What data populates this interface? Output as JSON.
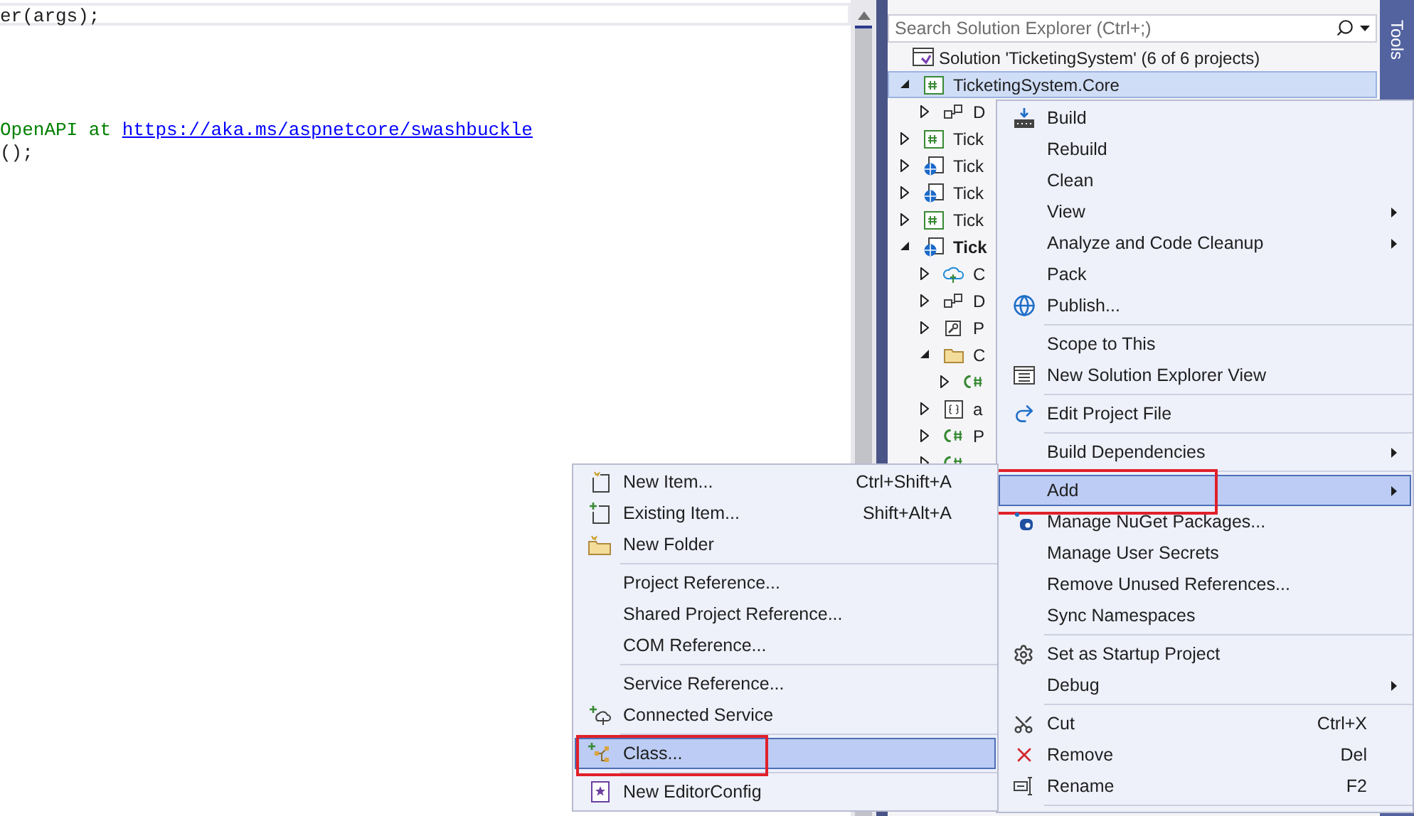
{
  "editor": {
    "lines": [
      {
        "kind": "code",
        "current": true,
        "segments": [
          {
            "kind": "code",
            "text": "er(args);"
          }
        ]
      },
      {
        "kind": "blank",
        "current": false
      },
      {
        "kind": "blank",
        "current": false
      },
      {
        "kind": "blank",
        "current": false
      },
      {
        "kind": "blank",
        "current": false
      },
      {
        "kind": "code",
        "current": false,
        "segments": [
          {
            "kind": "comment",
            "text": "OpenAPI at "
          },
          {
            "kind": "link",
            "text": "https://aka.ms/aspnetcore/swashbuckle"
          }
        ]
      },
      {
        "kind": "code",
        "current": false,
        "segments": [
          {
            "kind": "code",
            "text": "();"
          }
        ]
      }
    ]
  },
  "solution_explorer": {
    "search": {
      "placeholder": "Search Solution Explorer (Ctrl+;)"
    },
    "side_tab": "Tools",
    "solution": {
      "label": "Solution 'TicketingSystem' (6 of 6 projects)"
    },
    "projects": [
      {
        "kind": "csproj",
        "label": "TicketingSystem.Core",
        "expanded": true,
        "selected": true,
        "startup": false,
        "children": [
          {
            "kind": "deps",
            "label": "D",
            "expanded": false,
            "selected": false
          }
        ]
      },
      {
        "kind": "csproj",
        "label": "Tick",
        "expanded": false,
        "selected": false,
        "startup": false
      },
      {
        "kind": "webproj",
        "label": "Tick",
        "expanded": false,
        "selected": false,
        "startup": false
      },
      {
        "kind": "webproj",
        "label": "Tick",
        "expanded": false,
        "selected": false,
        "startup": false
      },
      {
        "kind": "csproj",
        "label": "Tick",
        "expanded": false,
        "selected": false,
        "startup": false
      },
      {
        "kind": "webproj",
        "label": "Tick",
        "expanded": true,
        "selected": false,
        "startup": true,
        "children": [
          {
            "kind": "connected",
            "label": "C",
            "expanded": false,
            "selected": false
          },
          {
            "kind": "deps",
            "label": "D",
            "expanded": false,
            "selected": false
          },
          {
            "kind": "props",
            "label": "P",
            "expanded": false,
            "selected": false
          },
          {
            "kind": "folder",
            "label": "C",
            "expanded": true,
            "selected": false,
            "children": [
              {
                "kind": "csfile",
                "expanded": false,
                "selected": false
              }
            ]
          },
          {
            "kind": "json",
            "label": "a",
            "expanded": false,
            "selected": false
          },
          {
            "kind": "csfile",
            "label": "P",
            "expanded": false,
            "selected": false
          },
          {
            "kind": "csfile",
            "expanded": false,
            "selected": false
          }
        ]
      }
    ]
  },
  "context_menu": {
    "items": [
      {
        "kind": "item",
        "label": "Build",
        "submenu": false,
        "selected": false
      },
      {
        "kind": "item",
        "label": "Rebuild",
        "submenu": false,
        "selected": false
      },
      {
        "kind": "item",
        "label": "Clean",
        "submenu": false,
        "selected": false
      },
      {
        "kind": "item",
        "label": "View",
        "submenu": true,
        "selected": false
      },
      {
        "kind": "item",
        "label": "Analyze and Code Cleanup",
        "submenu": true,
        "selected": false
      },
      {
        "kind": "item",
        "label": "Pack",
        "submenu": false,
        "selected": false
      },
      {
        "kind": "item",
        "label": "Publish...",
        "submenu": false,
        "selected": false
      },
      {
        "kind": "separator"
      },
      {
        "kind": "item",
        "label": "Scope to This",
        "submenu": false,
        "selected": false
      },
      {
        "kind": "item",
        "label": "New Solution Explorer View",
        "submenu": false,
        "selected": false
      },
      {
        "kind": "separator"
      },
      {
        "kind": "item",
        "label": "Edit Project File",
        "submenu": false,
        "selected": false
      },
      {
        "kind": "separator"
      },
      {
        "kind": "item",
        "label": "Build Dependencies",
        "submenu": true,
        "selected": false
      },
      {
        "kind": "separator"
      },
      {
        "kind": "item",
        "label": "Add",
        "submenu": true,
        "selected": true,
        "callout": true
      },
      {
        "kind": "item",
        "label": "Manage NuGet Packages...",
        "submenu": false,
        "selected": false
      },
      {
        "kind": "item",
        "label": "Manage User Secrets",
        "submenu": false,
        "selected": false
      },
      {
        "kind": "item",
        "label": "Remove Unused References...",
        "submenu": false,
        "selected": false
      },
      {
        "kind": "item",
        "label": "Sync Namespaces",
        "submenu": false,
        "selected": false
      },
      {
        "kind": "separator"
      },
      {
        "kind": "item",
        "label": "Set as Startup Project",
        "submenu": false,
        "selected": false
      },
      {
        "kind": "item",
        "label": "Debug",
        "submenu": true,
        "selected": false
      },
      {
        "kind": "separator"
      },
      {
        "kind": "item",
        "label": "Cut",
        "shortcut": "Ctrl+X",
        "submenu": false,
        "selected": false
      },
      {
        "kind": "item",
        "label": "Remove",
        "shortcut": "Del",
        "submenu": false,
        "selected": false
      },
      {
        "kind": "item",
        "label": "Rename",
        "shortcut": "F2",
        "submenu": false,
        "selected": false
      },
      {
        "kind": "separator"
      }
    ]
  },
  "add_submenu": {
    "items": [
      {
        "kind": "item",
        "label": "New Item...",
        "shortcut": "Ctrl+Shift+A",
        "submenu": false,
        "selected": false
      },
      {
        "kind": "item",
        "label": "Existing Item...",
        "shortcut": "Shift+Alt+A",
        "submenu": false,
        "selected": false
      },
      {
        "kind": "item",
        "label": "New Folder",
        "submenu": false,
        "selected": false
      },
      {
        "kind": "separator"
      },
      {
        "kind": "item",
        "label": "Project Reference...",
        "submenu": false,
        "selected": false
      },
      {
        "kind": "item",
        "label": "Shared Project Reference...",
        "submenu": false,
        "selected": false
      },
      {
        "kind": "item",
        "label": "COM Reference...",
        "submenu": false,
        "selected": false
      },
      {
        "kind": "separator"
      },
      {
        "kind": "item",
        "label": "Service Reference...",
        "submenu": false,
        "selected": false
      },
      {
        "kind": "item",
        "label": "Connected Service",
        "submenu": false,
        "selected": false
      },
      {
        "kind": "separator"
      },
      {
        "kind": "item",
        "label": "Class...",
        "submenu": false,
        "selected": true,
        "callout": true
      },
      {
        "kind": "separator"
      },
      {
        "kind": "item",
        "label": "New EditorConfig",
        "submenu": false,
        "selected": false
      }
    ]
  }
}
